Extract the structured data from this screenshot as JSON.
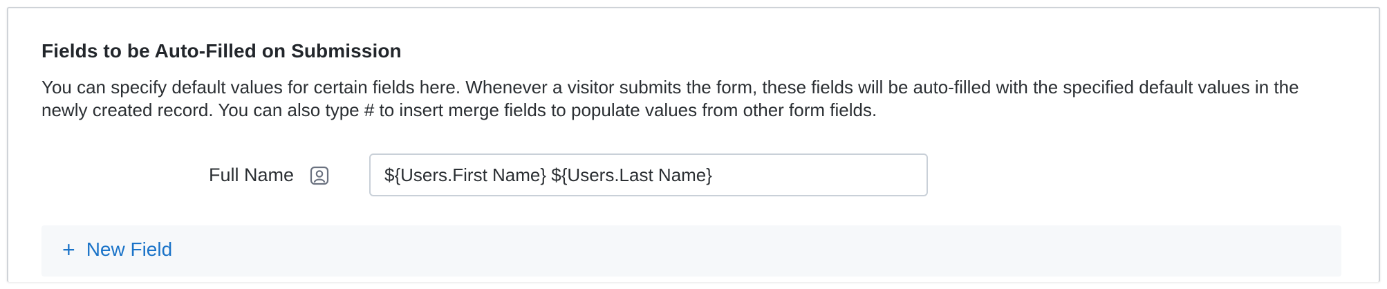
{
  "section": {
    "title": "Fields to be Auto-Filled on Submission",
    "description": "You can specify default values for certain fields here. Whenever a visitor submits the form, these fields will be auto-filled with the specified default values in the newly created record. You can also type # to insert merge fields to populate values from other form fields."
  },
  "fields": [
    {
      "label": "Full Name",
      "icon": "user-icon",
      "value": "${Users.First Name} ${Users.Last Name}"
    }
  ],
  "actions": {
    "new_field_icon": "plus-icon",
    "new_field_label": "New Field"
  },
  "colors": {
    "accent": "#1a73c8",
    "bar_background": "#f6f8fa",
    "input_border": "#c9d0d8"
  }
}
